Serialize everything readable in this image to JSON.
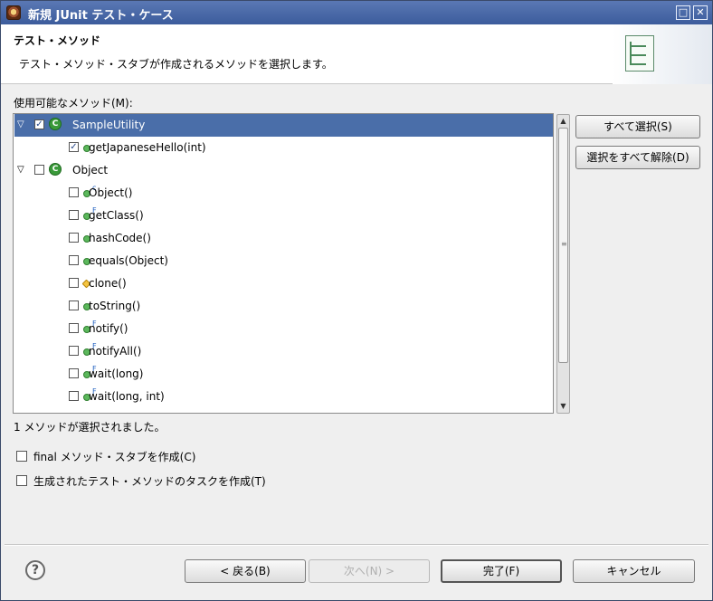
{
  "window": {
    "title": "新規 JUnit テスト・ケース",
    "maximize_icon": "maximize-icon",
    "close_icon": "close-icon"
  },
  "header": {
    "title": "テスト・メソッド",
    "description": "テスト・メソッド・スタブが作成されるメソッドを選択します。"
  },
  "methods_label": "使用可能なメソッド(M):",
  "tree": [
    {
      "label": "SampleUtility",
      "level": 0,
      "checked": true,
      "kind": "class",
      "expanded": true,
      "selected": true
    },
    {
      "label": "getJapaneseHello(int)",
      "level": 1,
      "checked": true,
      "kind": "method"
    },
    {
      "label": "Object",
      "level": 0,
      "checked": false,
      "kind": "class",
      "expanded": true
    },
    {
      "label": "Object()",
      "level": 1,
      "checked": false,
      "kind": "constructor",
      "overlay": "c"
    },
    {
      "label": "getClass()",
      "level": 1,
      "checked": false,
      "kind": "method",
      "overlay": "F"
    },
    {
      "label": "hashCode()",
      "level": 1,
      "checked": false,
      "kind": "method"
    },
    {
      "label": "equals(Object)",
      "level": 1,
      "checked": false,
      "kind": "method"
    },
    {
      "label": "clone()",
      "level": 1,
      "checked": false,
      "kind": "protected"
    },
    {
      "label": "toString()",
      "level": 1,
      "checked": false,
      "kind": "method"
    },
    {
      "label": "notify()",
      "level": 1,
      "checked": false,
      "kind": "method",
      "overlay": "F"
    },
    {
      "label": "notifyAll()",
      "level": 1,
      "checked": false,
      "kind": "method",
      "overlay": "F"
    },
    {
      "label": "wait(long)",
      "level": 1,
      "checked": false,
      "kind": "method",
      "overlay": "F"
    },
    {
      "label": "wait(long, int)",
      "level": 1,
      "checked": false,
      "kind": "method",
      "overlay": "F"
    }
  ],
  "side_buttons": {
    "select_all": "すべて選択(S)",
    "deselect_all": "選択をすべて解除(D)"
  },
  "status": "1 メソッドが選択されました。",
  "options": {
    "final_stubs": "final メソッド・スタブを作成(C)",
    "task_create": "生成されたテスト・メソッドのタスクを作成(T)"
  },
  "footer": {
    "back": "< 戻る(B)",
    "next": "次へ(N) >",
    "finish": "完了(F)",
    "cancel": "キャンセル",
    "help_glyph": "?"
  }
}
